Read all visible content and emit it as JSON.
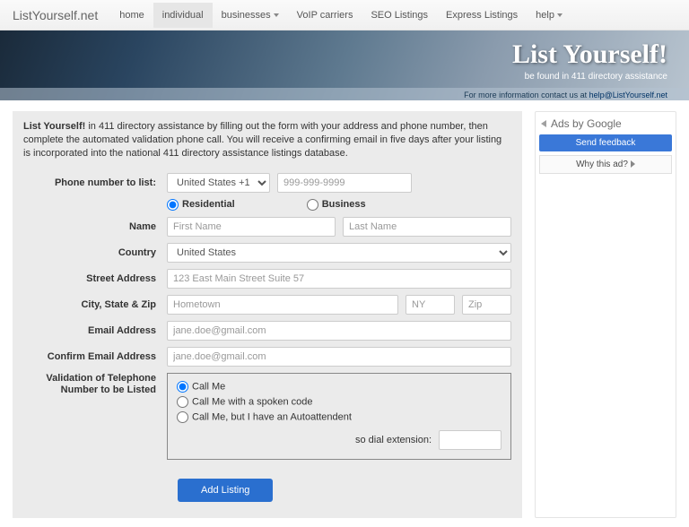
{
  "nav": {
    "brand": "ListYourself.net",
    "items": [
      "home",
      "individual",
      "businesses",
      "VoIP carriers",
      "SEO Listings",
      "Express Listings",
      "help"
    ],
    "activeIndex": 1,
    "dropdownIndices": [
      2,
      6
    ]
  },
  "hero": {
    "title": "List Yourself!",
    "subtitle": "be found in 411 directory assistance",
    "contactLead": "For more information contact us at ",
    "contactEmail": "help@ListYourself.net"
  },
  "intro": {
    "bold": "List Yourself!",
    "rest": " in 411 directory assistance by filling out the form with your address and phone number, then complete the automated validation phone call. You will receive a confirming email in five days after your listing is incorporated into the national 411 directory assistance listings database."
  },
  "form": {
    "phoneLabel": "Phone number to list:",
    "countryCode": "United States +1",
    "phonePlaceholder": "999-999-9999",
    "typeResidential": "Residential",
    "typeBusiness": "Business",
    "nameLabel": "Name",
    "firstNamePh": "First Name",
    "lastNamePh": "Last Name",
    "countryLabel": "Country",
    "countryValue": "United States",
    "streetLabel": "Street Address",
    "streetPh": "123 East Main Street Suite 57",
    "cszLabel": "City, State & Zip",
    "cityPh": "Hometown",
    "statePh": "NY",
    "zipPh": "Zip",
    "emailLabel": "Email Address",
    "emailPh": "jane.doe@gmail.com",
    "confirmEmailLabel": "Confirm Email Address",
    "validationLabel": "Validation of Telephone Number to be Listed",
    "valOpt1": "Call Me",
    "valOpt2": "Call Me with a spoken code",
    "valOpt3": "Call Me, but I have an Autoattendent",
    "extLabel": "so dial extension:",
    "submit": "Add Listing"
  },
  "ads": {
    "header": "Ads by Google",
    "feedback": "Send feedback",
    "why": "Why this ad?"
  }
}
